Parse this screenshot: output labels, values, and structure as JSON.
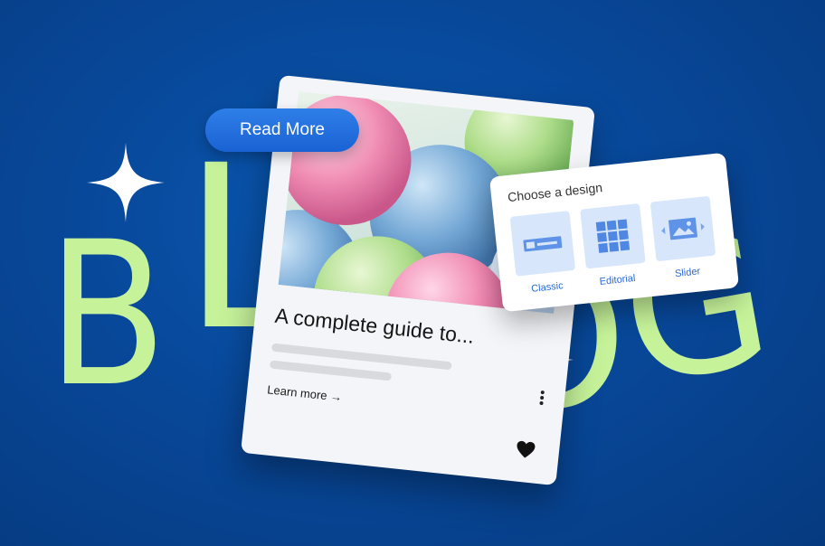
{
  "letters": [
    "B",
    "L",
    "O",
    "G"
  ],
  "read_more_label": "Read More",
  "card": {
    "title": "A complete guide to...",
    "link": "Learn more →",
    "kebab_icon": "kebab-menu-icon",
    "like_icon": "heart-icon"
  },
  "design_panel": {
    "title": "Choose a design",
    "options": [
      {
        "label": "Classic",
        "icon": "classic-layout-icon"
      },
      {
        "label": "Editorial",
        "icon": "editorial-grid-icon"
      },
      {
        "label": "Slider",
        "icon": "slider-layout-icon"
      }
    ]
  },
  "colors": {
    "background": "#08489a",
    "letters": "#c6f39a",
    "button": "#1f6ddb",
    "option_tile": "#d7e6fb"
  }
}
